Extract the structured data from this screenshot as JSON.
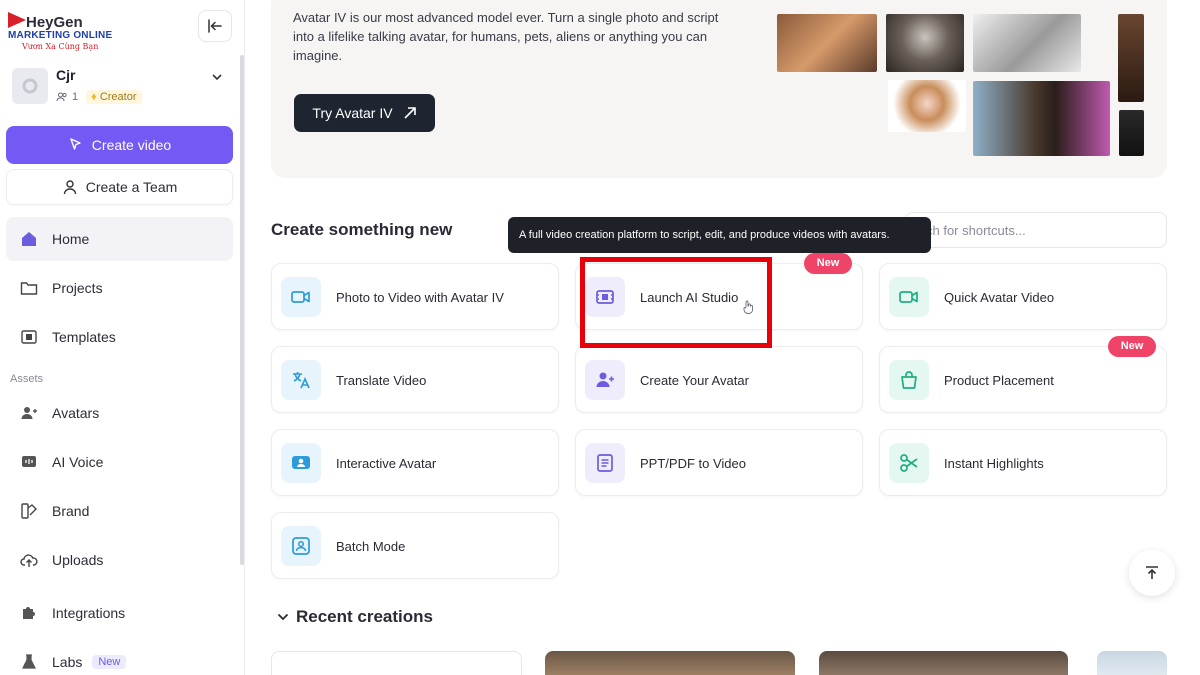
{
  "logo": {
    "brand": "HeyGen",
    "line1": "MARKETING ONLINE",
    "line2": "Vươn Xa Cùng Bạn"
  },
  "workspace": {
    "name": "Cjr",
    "members": "1",
    "plan": "Creator"
  },
  "sidebar": {
    "create_video": "Create video",
    "create_team": "Create a Team",
    "assets_label": "Assets",
    "items": [
      {
        "label": "Home",
        "icon": "home-icon"
      },
      {
        "label": "Projects",
        "icon": "folder-icon"
      },
      {
        "label": "Templates",
        "icon": "film-icon"
      },
      {
        "label": "Avatars",
        "icon": "avatar-icon"
      },
      {
        "label": "AI Voice",
        "icon": "voice-icon"
      },
      {
        "label": "Brand",
        "icon": "brand-icon"
      },
      {
        "label": "Uploads",
        "icon": "upload-cloud-icon"
      },
      {
        "label": "Integrations",
        "icon": "puzzle-icon"
      },
      {
        "label": "Labs",
        "icon": "flask-icon",
        "badge": "New"
      }
    ]
  },
  "banner": {
    "text": "Avatar IV is our most advanced model ever. Turn a single photo and script into a lifelike talking avatar, for humans, pets, aliens or anything you can imagine.",
    "button": "Try Avatar IV"
  },
  "create_section": {
    "title": "Create something new",
    "search_placeholder": "Search for shortcuts...",
    "search_visible": "ch for shortcuts...",
    "tooltip": "A full video creation platform to script, edit, and produce videos with avatars.",
    "cards": [
      {
        "label": "Photo to Video with Avatar IV",
        "icon": "camera-icon",
        "color": "blue"
      },
      {
        "label": "Launch AI Studio",
        "icon": "film-strip-icon",
        "color": "purple",
        "badge": "New"
      },
      {
        "label": "Quick Avatar Video",
        "icon": "video-camera-icon",
        "color": "green"
      },
      {
        "label": "Translate Video",
        "icon": "translate-icon",
        "color": "blue"
      },
      {
        "label": "Create Your Avatar",
        "icon": "add-user-icon",
        "color": "purple"
      },
      {
        "label": "Product Placement",
        "icon": "shopping-bag-icon",
        "color": "green",
        "badge": "New"
      },
      {
        "label": "Interactive Avatar",
        "icon": "chat-avatar-icon",
        "color": "blue"
      },
      {
        "label": "PPT/PDF to Video",
        "icon": "document-icon",
        "color": "purple"
      },
      {
        "label": "Instant Highlights",
        "icon": "scissors-icon",
        "color": "green"
      },
      {
        "label": "Batch Mode",
        "icon": "batch-icon",
        "color": "blue"
      }
    ]
  },
  "recent": {
    "title": "Recent creations"
  },
  "colors": {
    "accent": "#7559f5",
    "badge_red": "#ef4467",
    "highlight": "#e8000b",
    "icon_blue": "#2d9bd8",
    "icon_purple": "#6b5ce0",
    "icon_green": "#1fae84"
  }
}
